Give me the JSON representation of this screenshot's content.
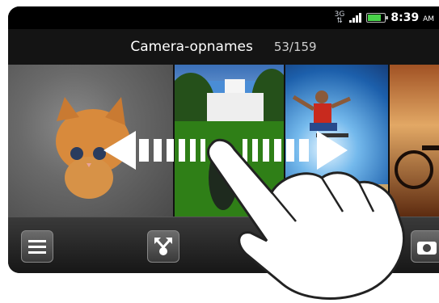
{
  "status_bar": {
    "network_type": "3G",
    "time": "8:39",
    "ampm": "AM"
  },
  "header": {
    "title": "Camera-opnames",
    "counter": "53/159"
  },
  "gallery": {
    "photos": [
      "kitten",
      "white-house",
      "skateboarder",
      "bicycle"
    ]
  },
  "toolbar": {
    "icons": [
      "menu-icon",
      "share-icon",
      "camera-icon"
    ]
  }
}
